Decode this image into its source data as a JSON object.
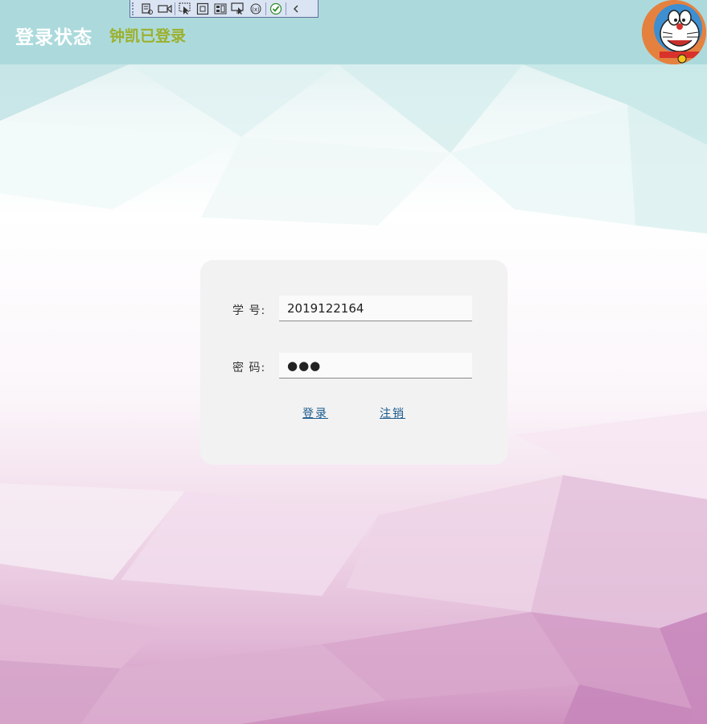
{
  "header": {
    "title": "登录状态",
    "user_status": "钟凯已登录"
  },
  "toolbar": {
    "icons": [
      "select-element-icon",
      "record-icon",
      "pointer-select-icon",
      "frame-icon",
      "layout-icon",
      "display-icon",
      "binding-icon",
      "check-icon",
      "collapse-icon"
    ]
  },
  "form": {
    "student_id_label": "学  号:",
    "student_id_value": "2019122164",
    "password_label": "密  码:",
    "password_value": "●●●",
    "login_label": "登录",
    "logout_label": "注销"
  },
  "colors": {
    "header_bg": "#acdadc",
    "title": "#ffffff",
    "user_status": "#9cb02c",
    "link": "#1a5a8e",
    "panel_bg": "#f2f2f2"
  }
}
